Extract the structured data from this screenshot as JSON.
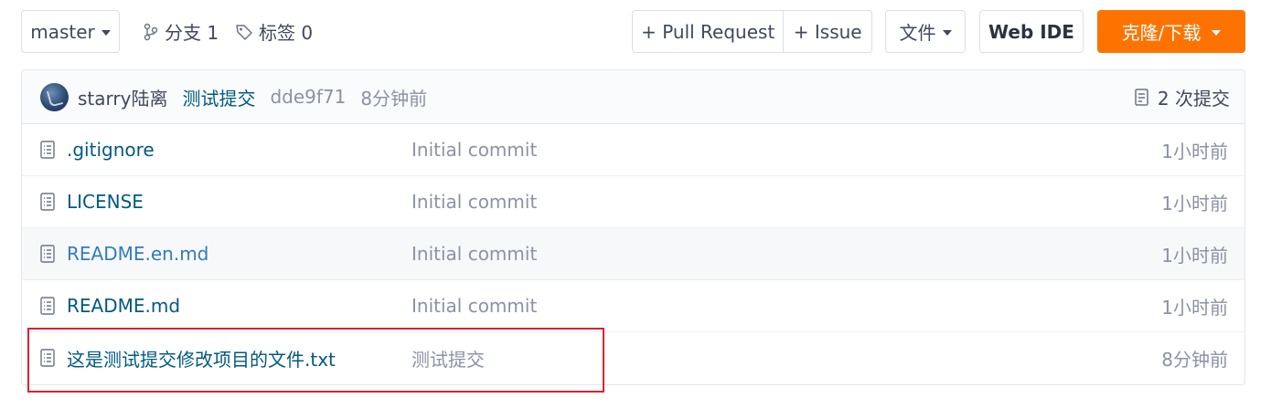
{
  "toolbar": {
    "branch_selector": "master",
    "branches_label": "分支 1",
    "tags_label": "标签 0",
    "pull_request_label": "+ Pull Request",
    "issue_label": "+ Issue",
    "file_menu_label": "文件",
    "web_ide_label": "Web IDE",
    "clone_label": "克隆/下载",
    "clone_color": "#fe7300"
  },
  "latest_commit": {
    "author": "starry陆离",
    "message": "测试提交",
    "sha": "dde9f71",
    "time": "8分钟前",
    "commit_count_label": "2 次提交"
  },
  "files": [
    {
      "name": ".gitignore",
      "message": "Initial commit",
      "time": "1小时前",
      "icon": "file-icon"
    },
    {
      "name": "LICENSE",
      "message": "Initial commit",
      "time": "1小时前",
      "icon": "file-icon"
    },
    {
      "name": "README.en.md",
      "message": "Initial commit",
      "time": "1小时前",
      "icon": "file-icon"
    },
    {
      "name": "README.md",
      "message": "Initial commit",
      "time": "1小时前",
      "icon": "file-icon"
    },
    {
      "name": "这是测试提交修改项目的文件.txt",
      "message": "测试提交",
      "time": "8分钟前",
      "icon": "file-icon"
    }
  ],
  "colors": {
    "link": "#005980",
    "link_hover": "#2f7dc0",
    "muted": "#8c92a4",
    "highlight_box": "#d9232d"
  }
}
